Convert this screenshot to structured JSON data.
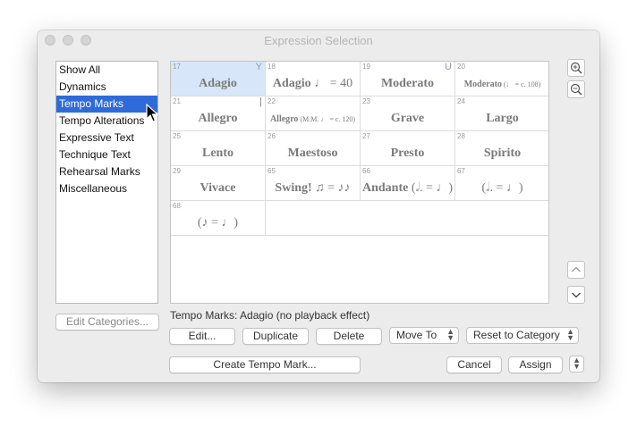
{
  "window": {
    "title": "Expression Selection"
  },
  "categories": [
    {
      "label": "Show All",
      "selected": false
    },
    {
      "label": "Dynamics",
      "selected": false
    },
    {
      "label": "Tempo Marks",
      "selected": true
    },
    {
      "label": "Tempo Alterations",
      "selected": false
    },
    {
      "label": "Expressive Text",
      "selected": false
    },
    {
      "label": "Technique Text",
      "selected": false
    },
    {
      "label": "Rehearsal Marks",
      "selected": false
    },
    {
      "label": "Miscellaneous",
      "selected": false
    }
  ],
  "cells": [
    {
      "num": "17",
      "flag": "Y",
      "pre": "",
      "text": "Adagio",
      "note": "",
      "eq": "",
      "post": "",
      "selected": true,
      "small": false
    },
    {
      "num": "18",
      "flag": "",
      "pre": "",
      "text": "Adagio ",
      "note": "♩",
      "eq": " = 40",
      "post": "",
      "selected": false,
      "small": false
    },
    {
      "num": "19",
      "flag": "U",
      "pre": "",
      "text": "Moderato",
      "note": "",
      "eq": "",
      "post": "",
      "selected": false,
      "small": false
    },
    {
      "num": "20",
      "flag": "",
      "pre": "",
      "text": "Moderato",
      "note": " (♩",
      "eq": " = c. 108)",
      "post": "",
      "selected": false,
      "small": true
    },
    {
      "num": "21",
      "flag": "|",
      "pre": "",
      "text": "Allegro",
      "note": "",
      "eq": "",
      "post": "",
      "selected": false,
      "small": false
    },
    {
      "num": "22",
      "flag": "",
      "pre": "",
      "text": "Allegro",
      "note": " (M.M. ♩",
      "eq": " = c. 120)",
      "post": "",
      "selected": false,
      "small": true
    },
    {
      "num": "23",
      "flag": "",
      "pre": "",
      "text": "Grave",
      "note": "",
      "eq": "",
      "post": "",
      "selected": false,
      "small": false
    },
    {
      "num": "24",
      "flag": "",
      "pre": "",
      "text": "Largo",
      "note": "",
      "eq": "",
      "post": "",
      "selected": false,
      "small": false
    },
    {
      "num": "25",
      "flag": "",
      "pre": "",
      "text": "Lento",
      "note": "",
      "eq": "",
      "post": "",
      "selected": false,
      "small": false
    },
    {
      "num": "26",
      "flag": "",
      "pre": "",
      "text": "Maestoso",
      "note": "",
      "eq": "",
      "post": "",
      "selected": false,
      "small": false
    },
    {
      "num": "27",
      "flag": "",
      "pre": "",
      "text": "Presto",
      "note": "",
      "eq": "",
      "post": "",
      "selected": false,
      "small": false
    },
    {
      "num": "28",
      "flag": "",
      "pre": "",
      "text": "Spirito",
      "note": "",
      "eq": "",
      "post": "",
      "selected": false,
      "small": false
    },
    {
      "num": "29",
      "flag": "",
      "pre": "",
      "text": "Vivace",
      "note": "",
      "eq": "",
      "post": "",
      "selected": false,
      "small": false
    },
    {
      "num": "65",
      "flag": "",
      "pre": "",
      "text": "Swing! ",
      "note": "♫ = ♪♪",
      "eq": "",
      "post": "",
      "selected": false,
      "small": false
    },
    {
      "num": "66",
      "flag": "",
      "pre": "",
      "text": "Andante ",
      "note": "(𝅗𝅥. = ♩)",
      "eq": "",
      "post": "",
      "selected": false,
      "small": false
    },
    {
      "num": "67",
      "flag": "",
      "pre": "",
      "text": "",
      "note": "(𝅗𝅥. = ♩)",
      "eq": "",
      "post": "",
      "selected": false,
      "small": false
    },
    {
      "num": "68",
      "flag": "",
      "pre": "",
      "text": "",
      "note": "(♪ = ♩)",
      "eq": "",
      "post": "",
      "selected": false,
      "small": false
    }
  ],
  "status": "Tempo Marks: Adagio (no playback effect)",
  "buttons": {
    "edit_categories": "Edit Categories...",
    "edit": "Edit...",
    "duplicate": "Duplicate",
    "delete": "Delete",
    "move_to": "Move To",
    "reset_to_category": "Reset to Category",
    "create": "Create Tempo Mark...",
    "cancel": "Cancel",
    "assign": "Assign"
  },
  "icons": {
    "zoom_in": "zoom-in-icon",
    "zoom_out": "zoom-out-icon",
    "scroll_up": "chevron-up-icon",
    "scroll_down": "chevron-down-icon",
    "cursor": "cursor-arrow-icon"
  }
}
